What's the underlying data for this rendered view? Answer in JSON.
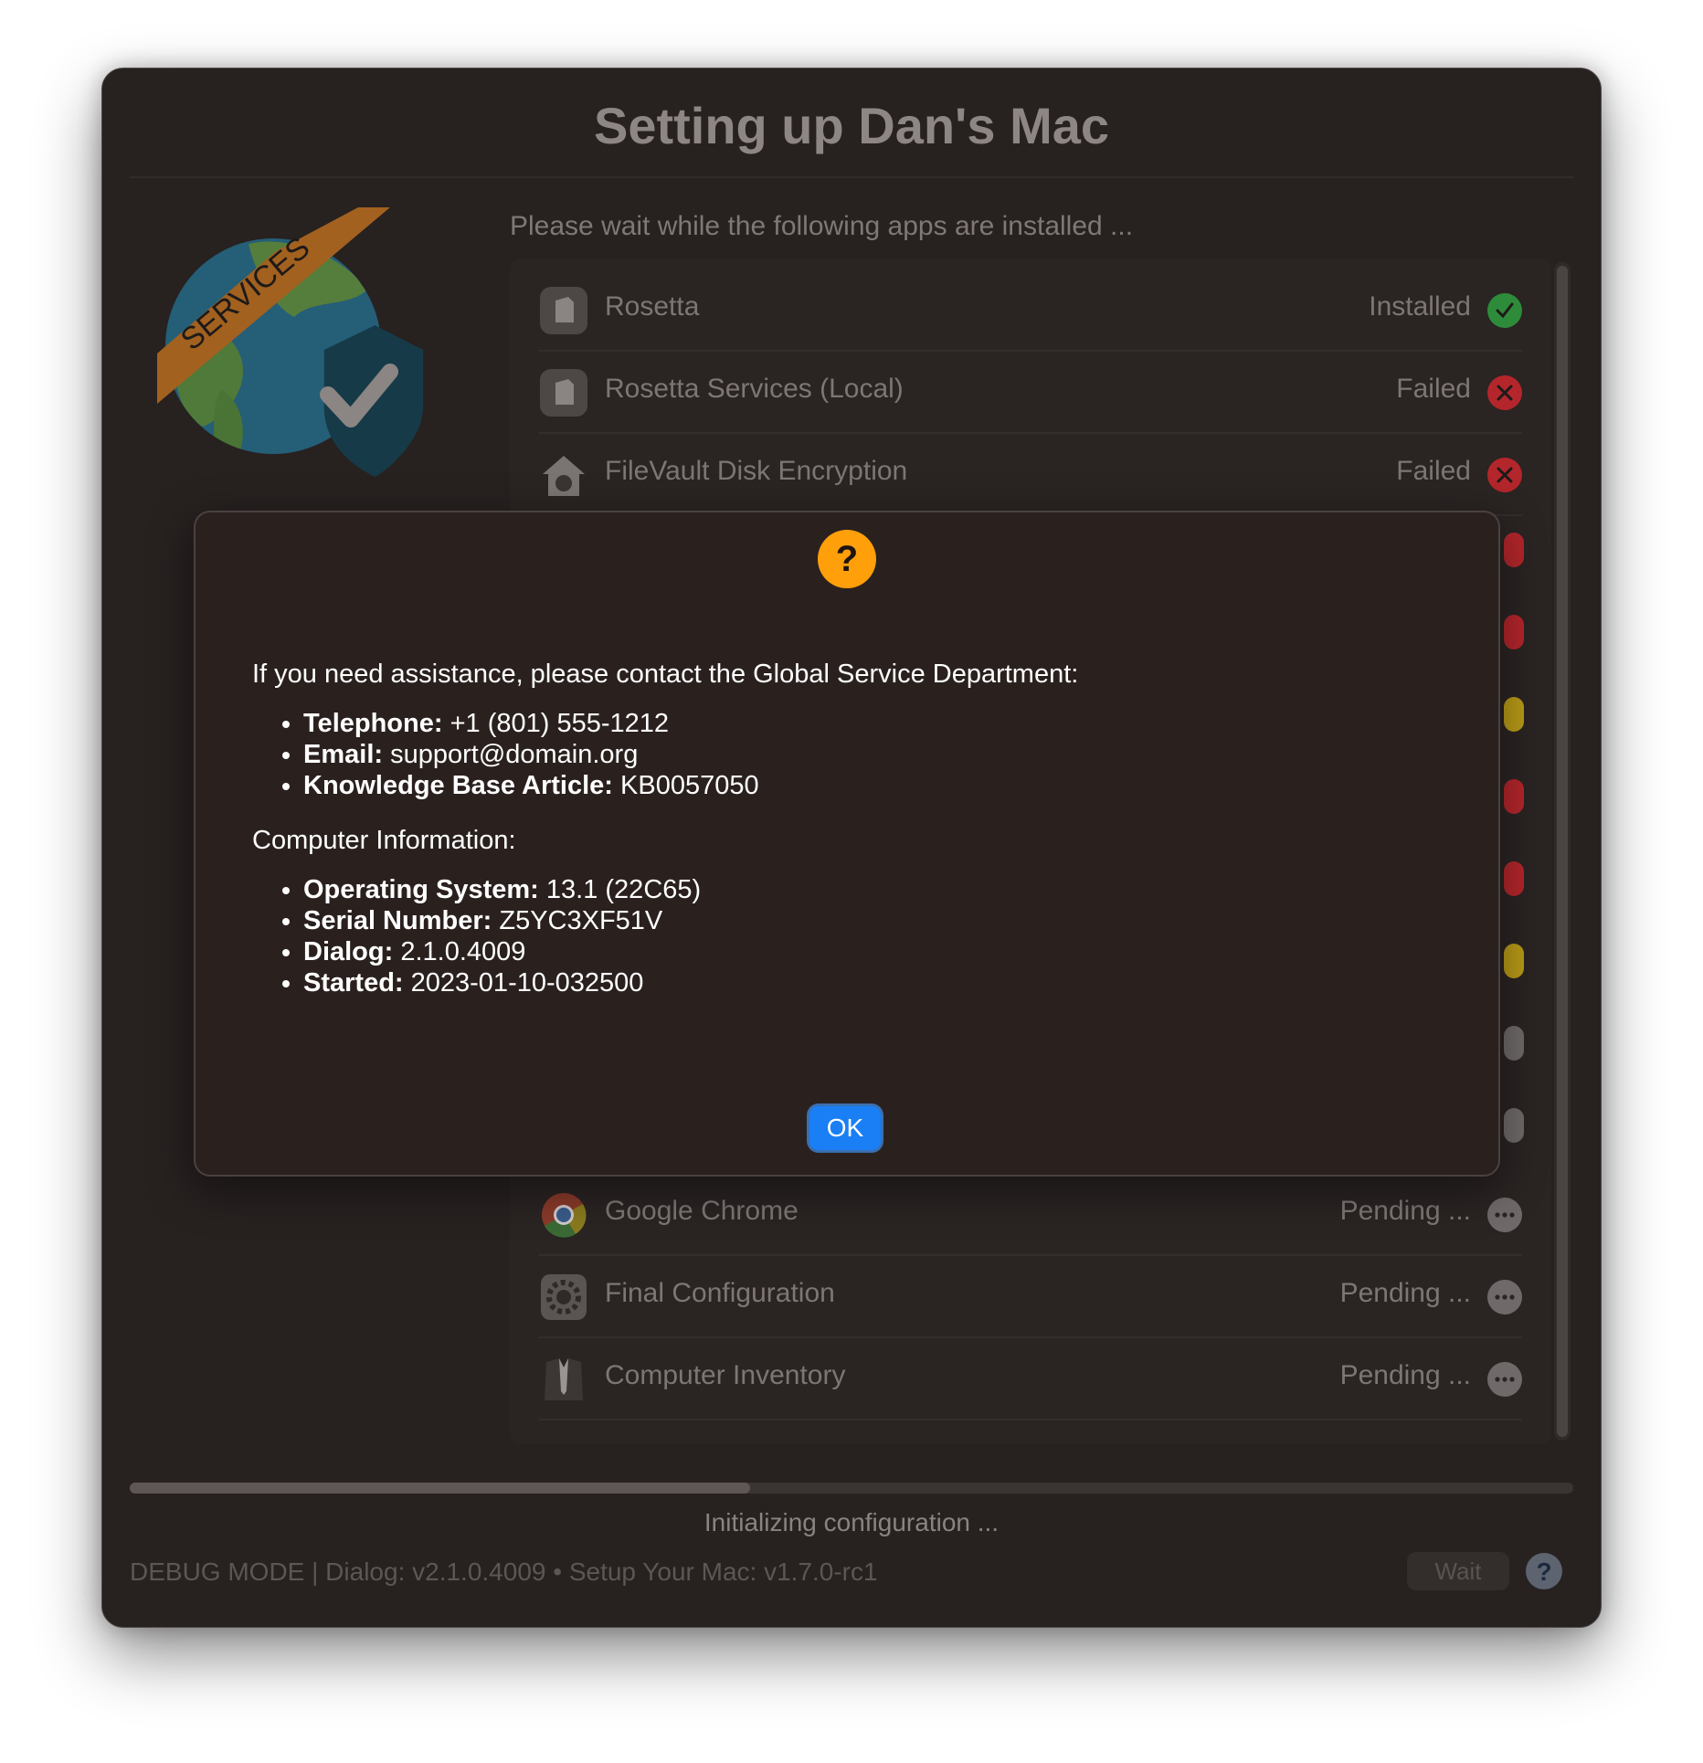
{
  "window": {
    "title": "Setting up Dan's Mac",
    "subtitle": "Please wait while the following apps are installed ..."
  },
  "logo": {
    "banner_text": "SERVICES",
    "icon": "globe-shield-check-icon"
  },
  "apps": [
    {
      "name": "Rosetta",
      "status": "Installed",
      "status_icon": "checkmark-circle-icon",
      "status_color": "#2e8b3a",
      "icon": "rosetta-icon"
    },
    {
      "name": "Rosetta Services (Local)",
      "status": "Failed",
      "status_icon": "x-circle-icon",
      "status_color": "#b3262b",
      "icon": "rosetta-icon"
    },
    {
      "name": "FileVault Disk Encryption",
      "status": "Failed",
      "status_icon": "x-circle-icon",
      "status_color": "#b3262b",
      "icon": "filevault-house-icon"
    },
    {
      "name": "Google Chrome",
      "status": "Pending ...",
      "status_icon": "ellipsis-circle-icon",
      "status_color": "#6f6a69",
      "icon": "chrome-icon"
    },
    {
      "name": "Final Configuration",
      "status": "Pending ...",
      "status_icon": "ellipsis-circle-icon",
      "status_color": "#6f6a69",
      "icon": "gear-icon"
    },
    {
      "name": "Computer Inventory",
      "status": "Pending ...",
      "status_icon": "ellipsis-circle-icon",
      "status_color": "#6f6a69",
      "icon": "tuxedo-icon"
    }
  ],
  "hidden_status_colors": [
    "#b3262b",
    "#b3262b",
    "#b89a17",
    "#b3262b",
    "#b3262b",
    "#b89a17",
    "#6f6a69",
    "#6f6a69"
  ],
  "progress": {
    "fraction": 0.43,
    "text": "Initializing configuration ..."
  },
  "footer": {
    "text": "DEBUG MODE | Dialog: v2.1.0.4009 • Setup Your Mac: v1.7.0-rc1",
    "wait_label": "Wait",
    "help_icon": "question-circle-icon"
  },
  "modal": {
    "icon": "question-circle-icon",
    "icon_color": "#ff9f0a",
    "intro": "If you need assistance, please contact the Global Service Department:",
    "contacts": [
      {
        "label": "Telephone:",
        "value": " +1 (801) 555-1212"
      },
      {
        "label": "Email:",
        "value": " support@domain.org"
      },
      {
        "label": "Knowledge Base Article:",
        "value": " KB0057050"
      }
    ],
    "computer_heading": "Computer Information:",
    "computer_info": [
      {
        "label": "Operating System:",
        "value": " 13.1 (22C65)"
      },
      {
        "label": "Serial Number:",
        "value": " Z5YC3XF51V"
      },
      {
        "label": "Dialog:",
        "value": " 2.1.0.4009"
      },
      {
        "label": "Started:",
        "value": " 2023-01-10-032500"
      }
    ],
    "ok_label": "OK",
    "ok_color": "#1a7ff5"
  }
}
